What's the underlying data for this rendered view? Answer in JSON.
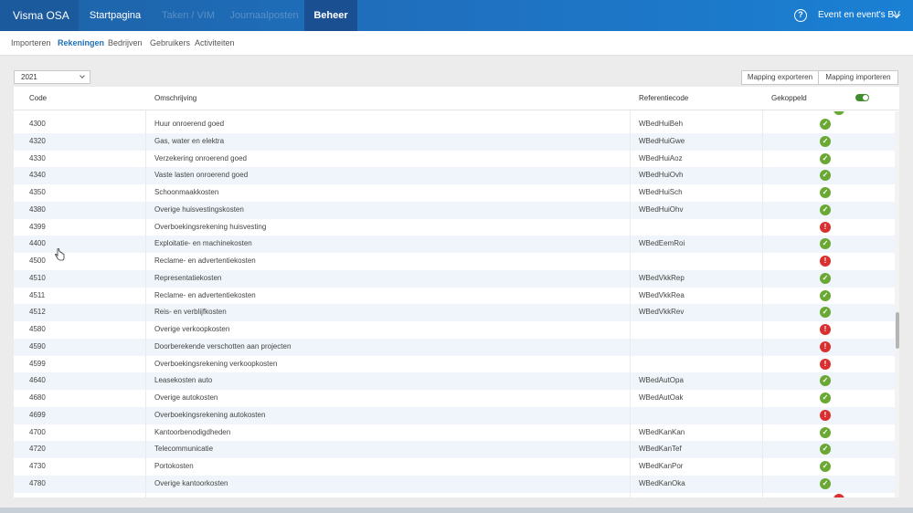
{
  "app": {
    "brand": "Visma OSA"
  },
  "nav": {
    "tabs": [
      {
        "label": "Startpagina"
      },
      {
        "label": "Taken / VIM"
      },
      {
        "label": "Journaalposten"
      },
      {
        "label": "Beheer"
      }
    ],
    "company": "Event en event's BV"
  },
  "subnav": {
    "tabs": [
      {
        "label": "Importeren"
      },
      {
        "label": "Rekeningen"
      },
      {
        "label": "Bedrijven"
      },
      {
        "label": "Gebruikers"
      },
      {
        "label": "Activiteiten"
      }
    ],
    "active": "Rekeningen"
  },
  "controls": {
    "year": "2021",
    "export_label": "Mapping exporteren",
    "import_label": "Mapping importeren"
  },
  "table": {
    "headers": {
      "code": "Code",
      "desc": "Omschrijving",
      "ref": "Referentiecode",
      "linked": "Gekoppeld"
    },
    "toggle_on": true,
    "rows": [
      {
        "code": "4300",
        "desc": "Huur onroerend goed",
        "ref": "WBedHuiBeh",
        "status": "ok"
      },
      {
        "code": "4320",
        "desc": "Gas, water en elektra",
        "ref": "WBedHuiGwe",
        "status": "ok"
      },
      {
        "code": "4330",
        "desc": "Verzekering onroerend goed",
        "ref": "WBedHuiAoz",
        "status": "ok"
      },
      {
        "code": "4340",
        "desc": "Vaste lasten onroerend goed",
        "ref": "WBedHuiOvh",
        "status": "ok"
      },
      {
        "code": "4350",
        "desc": "Schoonmaakkosten",
        "ref": "WBedHuiSch",
        "status": "ok"
      },
      {
        "code": "4380",
        "desc": "Overige huisvestingskosten",
        "ref": "WBedHuiOhv",
        "status": "ok"
      },
      {
        "code": "4399",
        "desc": "Overboekingsrekening huisvesting",
        "ref": "",
        "status": "err"
      },
      {
        "code": "4400",
        "desc": "Exploitatie- en machinekosten",
        "ref": "WBedEemRoi",
        "status": "ok"
      },
      {
        "code": "4500",
        "desc": "Reclame- en advertentiekosten",
        "ref": "",
        "status": "err"
      },
      {
        "code": "4510",
        "desc": "Representatiekosten",
        "ref": "WBedVkkRep",
        "status": "ok"
      },
      {
        "code": "4511",
        "desc": "Reclame- en advertentiekosten",
        "ref": "WBedVkkRea",
        "status": "ok"
      },
      {
        "code": "4512",
        "desc": "Reis- en verblijfkosten",
        "ref": "WBedVkkRev",
        "status": "ok"
      },
      {
        "code": "4580",
        "desc": "Overige verkoopkosten",
        "ref": "",
        "status": "err"
      },
      {
        "code": "4590",
        "desc": "Doorberekende verschotten aan projecten",
        "ref": "",
        "status": "err"
      },
      {
        "code": "4599",
        "desc": "Overboekingsrekening verkoopkosten",
        "ref": "",
        "status": "err"
      },
      {
        "code": "4640",
        "desc": "Leasekosten auto",
        "ref": "WBedAutOpa",
        "status": "ok"
      },
      {
        "code": "4680",
        "desc": "Overige autokosten",
        "ref": "WBedAutOak",
        "status": "ok"
      },
      {
        "code": "4699",
        "desc": "Overboekingsrekening autokosten",
        "ref": "",
        "status": "err"
      },
      {
        "code": "4700",
        "desc": "Kantoorbenodigdheden",
        "ref": "WBedKanKan",
        "status": "ok"
      },
      {
        "code": "4720",
        "desc": "Telecommunicatie",
        "ref": "WBedKanTef",
        "status": "ok"
      },
      {
        "code": "4730",
        "desc": "Portokosten",
        "ref": "WBedKanPor",
        "status": "ok"
      },
      {
        "code": "4780",
        "desc": "Overige kantoorkosten",
        "ref": "WBedKanOka",
        "status": "ok"
      }
    ]
  },
  "icons": {
    "ok": "check-icon",
    "err": "exclamation-icon",
    "help": "help-icon",
    "cursor": "hand-cursor-icon"
  },
  "colors": {
    "nav": "#1f72c2",
    "active_tab": "#1a5092",
    "ok": "#6aa834",
    "err": "#d9302f",
    "row_alt": "#eff5fa",
    "accent": "#1f6fb8"
  }
}
